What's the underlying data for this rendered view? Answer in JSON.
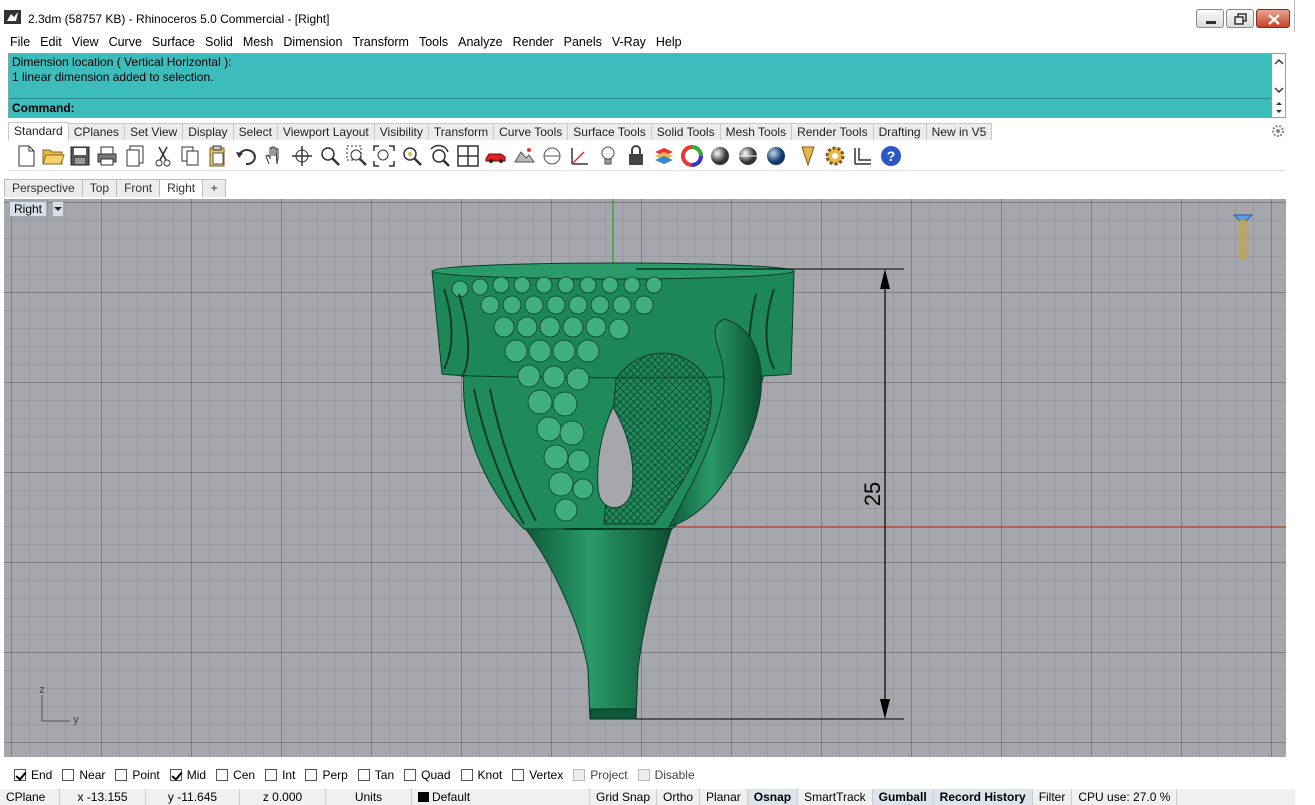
{
  "window": {
    "title": "2.3dm (58757 KB) - Rhinoceros 5.0 Commercial - [Right]"
  },
  "menu": [
    "File",
    "Edit",
    "View",
    "Curve",
    "Surface",
    "Solid",
    "Mesh",
    "Dimension",
    "Transform",
    "Tools",
    "Analyze",
    "Render",
    "Panels",
    "V-Ray",
    "Help"
  ],
  "command": {
    "history": [
      "Dimension location ( Vertical  Horizontal ):",
      "1 linear dimension added to selection."
    ],
    "prompt_label": "Command:",
    "value": ""
  },
  "toolbar_tabs": {
    "active": "Standard",
    "items": [
      "Standard",
      "CPlanes",
      "Set View",
      "Display",
      "Select",
      "Viewport Layout",
      "Visibility",
      "Transform",
      "Curve Tools",
      "Surface Tools",
      "Solid Tools",
      "Mesh Tools",
      "Render Tools",
      "Drafting",
      "New in V5"
    ]
  },
  "toolbar_icons": [
    "new-file-icon",
    "open-folder-icon",
    "save-icon",
    "print-icon",
    "import-icon",
    "cut-icon",
    "copy-icon",
    "paste-icon",
    "undo-icon",
    "pan-hand-icon",
    "rotate-view-icon",
    "zoom-icon",
    "zoom-window-icon",
    "zoom-extents-icon",
    "zoom-selected-icon",
    "undo-view-icon",
    "four-viewports-icon",
    "car-named-view-icon",
    "background-bitmap-icon",
    "cplane-icon",
    "set-cplane-icon",
    "lightbulb-icon",
    "lock-icon",
    "layer-icon",
    "color-wheel-icon",
    "material-sphere-icon",
    "render-sphere-icon",
    "render-preview-icon",
    "object-properties-icon",
    "options-gear-icon",
    "dimension-icon",
    "help-icon"
  ],
  "viewport_tabs": {
    "active": "Right",
    "items": [
      "Perspective",
      "Top",
      "Front",
      "Right"
    ],
    "add_label": "+"
  },
  "viewport": {
    "name": "Right",
    "dimension_value": "25",
    "axis_labels": {
      "vertical": "z",
      "horizontal": "y"
    },
    "colors": {
      "background": "#a5a7ac",
      "model": "#1f8a5a",
      "x_axis": "#c0392b",
      "y_axis": "#2e9d3b"
    }
  },
  "osnaps": [
    {
      "label": "End",
      "checked": true
    },
    {
      "label": "Near",
      "checked": false
    },
    {
      "label": "Point",
      "checked": false
    },
    {
      "label": "Mid",
      "checked": true
    },
    {
      "label": "Cen",
      "checked": false
    },
    {
      "label": "Int",
      "checked": false
    },
    {
      "label": "Perp",
      "checked": false
    },
    {
      "label": "Tan",
      "checked": false
    },
    {
      "label": "Quad",
      "checked": false
    },
    {
      "label": "Knot",
      "checked": false
    },
    {
      "label": "Vertex",
      "checked": false
    },
    {
      "label": "Project",
      "checked": false,
      "disabled": true
    },
    {
      "label": "Disable",
      "checked": false,
      "disabled": true
    }
  ],
  "status": {
    "cplane": "CPlane",
    "x": "x -13.155",
    "y": "y -11.645",
    "z": "z 0.000",
    "units": "Units",
    "layer": "Default",
    "toggles": [
      {
        "label": "Grid Snap",
        "on": false
      },
      {
        "label": "Ortho",
        "on": false
      },
      {
        "label": "Planar",
        "on": false
      },
      {
        "label": "Osnap",
        "on": true
      },
      {
        "label": "SmartTrack",
        "on": false
      },
      {
        "label": "Gumball",
        "on": true
      },
      {
        "label": "Record History",
        "on": true
      },
      {
        "label": "Filter",
        "on": false
      }
    ],
    "cpu": "CPU use: 27.0 %"
  }
}
